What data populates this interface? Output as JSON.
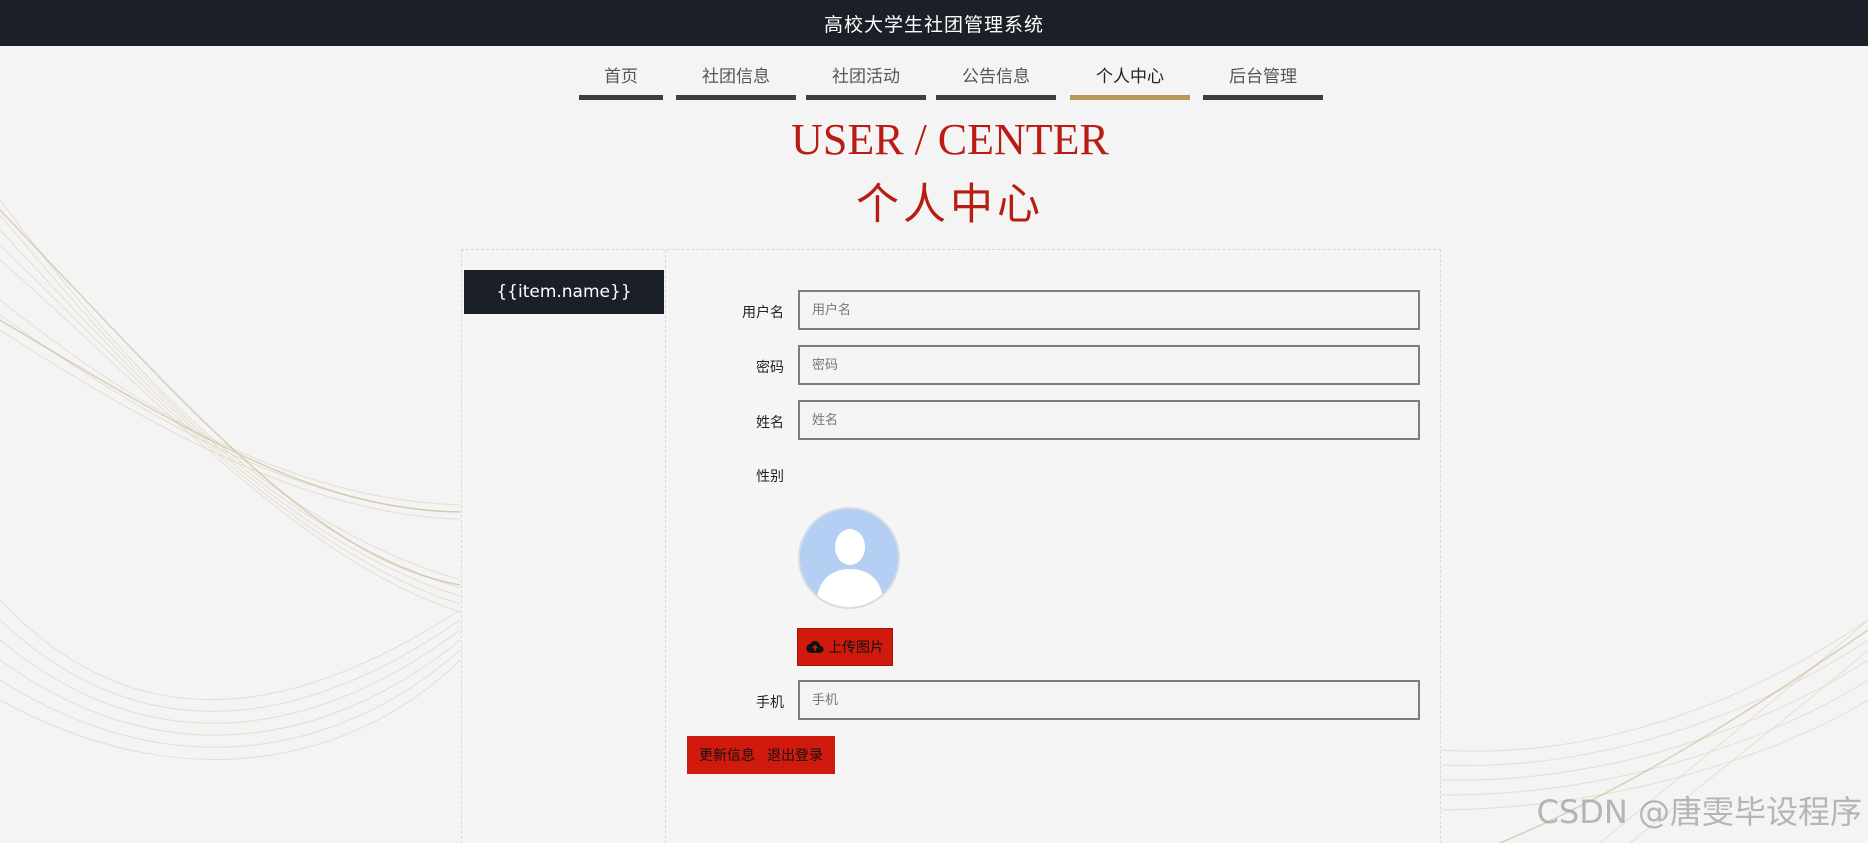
{
  "app": {
    "title": "高校大学生社团管理系统"
  },
  "nav": {
    "items": [
      {
        "label": "首页"
      },
      {
        "label": "社团信息"
      },
      {
        "label": "社团活动"
      },
      {
        "label": "公告信息"
      },
      {
        "label": "个人中心",
        "active": true
      },
      {
        "label": "后台管理"
      }
    ]
  },
  "page": {
    "title_en": "USER / CENTER",
    "title_zh": "个人中心"
  },
  "sidebar": {
    "items": [
      {
        "label": "{{item.name}}"
      }
    ]
  },
  "form": {
    "username": {
      "label": "用户名",
      "placeholder": "用户名",
      "value": ""
    },
    "password": {
      "label": "密码",
      "placeholder": "密码",
      "value": ""
    },
    "name": {
      "label": "姓名",
      "placeholder": "姓名",
      "value": ""
    },
    "gender": {
      "label": "性别"
    },
    "avatar": {
      "icon": "default-user-avatar"
    },
    "upload": {
      "label": "上传图片",
      "icon": "cloud-upload-icon"
    },
    "phone": {
      "label": "手机",
      "placeholder": "手机",
      "value": ""
    }
  },
  "actions": {
    "update": "更新信息",
    "logout": "退出登录"
  },
  "watermark": "CSDN @唐雯毕设程序",
  "colors": {
    "topbar": "#1b1f27",
    "accent_red": "#b81c12",
    "button_red": "#d11a0e",
    "nav_active_underline": "#b7975a",
    "nav_underline": "#3d3f43"
  }
}
